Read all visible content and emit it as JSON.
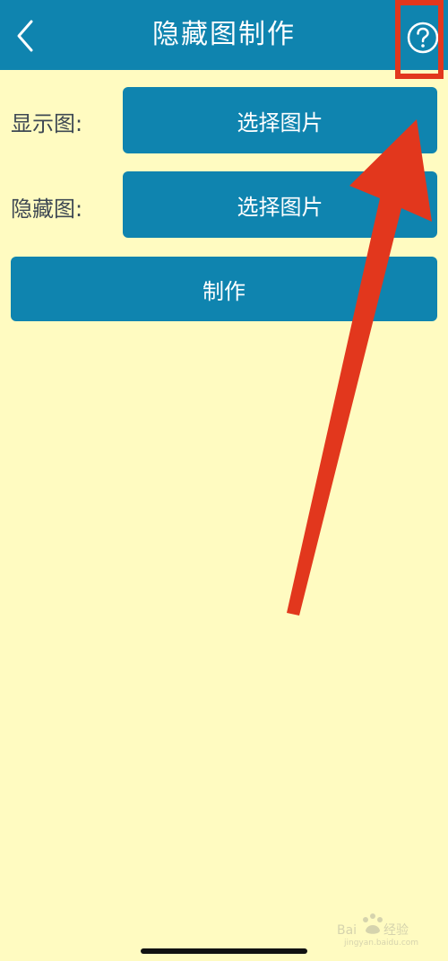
{
  "appbar": {
    "title": "隐藏图制作",
    "back_icon": "chevron-left-icon",
    "help_icon": "question-circle-icon"
  },
  "form": {
    "display_label": "显示图:",
    "display_button": "选择图片",
    "hidden_label": "隐藏图:",
    "hidden_button": "选择图片",
    "make_button": "制作"
  },
  "annotation": {
    "color": "#E2371D",
    "target": "help-button"
  },
  "colors": {
    "primary": "#0F84AF",
    "background": "#FFFBC1",
    "label_text": "#3E4853",
    "annotation": "#E2371D"
  }
}
